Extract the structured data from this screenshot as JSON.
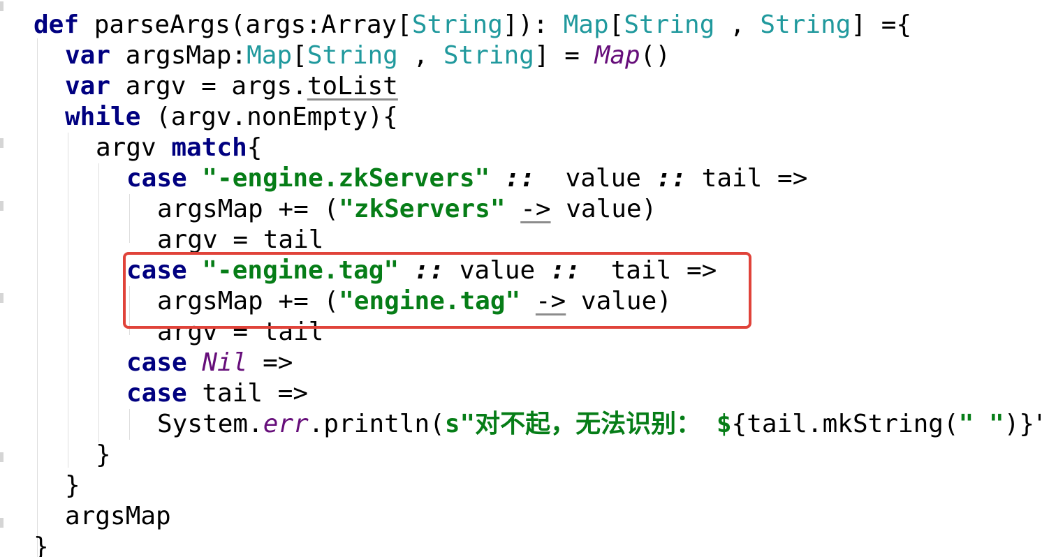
{
  "editor": {
    "lines": [
      {
        "tokens": [
          {
            "t": "def ",
            "c": "kw"
          },
          {
            "t": "parseArgs(args:Array["
          },
          {
            "t": "String",
            "c": "ty"
          },
          {
            "t": "]): "
          },
          {
            "t": "Map",
            "c": "ty"
          },
          {
            "t": "["
          },
          {
            "t": "String",
            "c": "ty"
          },
          {
            "t": " , "
          },
          {
            "t": "String",
            "c": "ty"
          },
          {
            "t": "] ={"
          }
        ]
      },
      {
        "tokens": [
          {
            "t": "var ",
            "c": "kw"
          },
          {
            "t": "argsMap:"
          },
          {
            "t": "Map",
            "c": "ty"
          },
          {
            "t": "["
          },
          {
            "t": "String",
            "c": "ty"
          },
          {
            "t": " , "
          },
          {
            "t": "String",
            "c": "ty"
          },
          {
            "t": "] = "
          },
          {
            "t": "Map",
            "c": "obj"
          },
          {
            "t": "()"
          }
        ]
      },
      {
        "tokens": [
          {
            "t": "var ",
            "c": "kw"
          },
          {
            "t": "argv = args."
          },
          {
            "t": "toList",
            "c": "ul"
          }
        ]
      },
      {
        "tokens": [
          {
            "t": "while ",
            "c": "kw"
          },
          {
            "t": "(argv.nonEmpty){"
          }
        ]
      },
      {
        "tokens": [
          {
            "t": "argv "
          },
          {
            "t": "match",
            "c": "kw"
          },
          {
            "t": "{"
          }
        ]
      },
      {
        "tokens": [
          {
            "t": "case ",
            "c": "kw"
          },
          {
            "t": "\"-engine.zkServers\"",
            "c": "str"
          },
          {
            "t": " "
          },
          {
            "t": "::",
            "c": "op"
          },
          {
            "t": "  value "
          },
          {
            "t": "::",
            "c": "op"
          },
          {
            "t": " tail =>"
          }
        ]
      },
      {
        "tokens": [
          {
            "t": "argsMap += ("
          },
          {
            "t": "\"zkServers\"",
            "c": "str"
          },
          {
            "t": " "
          },
          {
            "t": "->",
            "c": "ul"
          },
          {
            "t": " value)"
          }
        ]
      },
      {
        "tokens": [
          {
            "t": "argv = tail"
          }
        ]
      },
      {
        "tokens": [
          {
            "t": "case ",
            "c": "kw"
          },
          {
            "t": "\"-engine.tag\"",
            "c": "str"
          },
          {
            "t": " "
          },
          {
            "t": "::",
            "c": "op"
          },
          {
            "t": " value "
          },
          {
            "t": "::",
            "c": "op"
          },
          {
            "t": "  tail =>"
          }
        ]
      },
      {
        "tokens": [
          {
            "t": "argsMap += ("
          },
          {
            "t": "\"engine.tag\"",
            "c": "str"
          },
          {
            "t": " "
          },
          {
            "t": "->",
            "c": "ul"
          },
          {
            "t": " value)"
          }
        ]
      },
      {
        "tokens": [
          {
            "t": "argv = tail"
          }
        ]
      },
      {
        "tokens": [
          {
            "t": "case ",
            "c": "kw"
          },
          {
            "t": "Nil",
            "c": "obj"
          },
          {
            "t": " =>"
          }
        ]
      },
      {
        "tokens": [
          {
            "t": "case ",
            "c": "kw"
          },
          {
            "t": "tail =>"
          }
        ]
      },
      {
        "tokens": [
          {
            "t": "System."
          },
          {
            "t": "err",
            "c": "obj"
          },
          {
            "t": ".println("
          },
          {
            "t": "s\"对不起，无法识别： ",
            "c": "str"
          },
          {
            "t": "$",
            "c": "str"
          },
          {
            "t": "{tail.mkString("
          },
          {
            "t": "\" \"",
            "c": "str"
          },
          {
            "t": ")}\""
          }
        ]
      },
      {
        "tokens": [
          {
            "t": "}"
          }
        ]
      },
      {
        "tokens": [
          {
            "t": "}"
          }
        ]
      },
      {
        "tokens": [
          {
            "t": "argsMap"
          }
        ]
      },
      {
        "tokens": [
          {
            "t": "}"
          }
        ]
      }
    ]
  },
  "colors": {
    "keyword": "#000080",
    "type": "#20999d",
    "italic_object": "#660e7a",
    "string": "#067d17",
    "highlight_border": "#e0433a"
  }
}
